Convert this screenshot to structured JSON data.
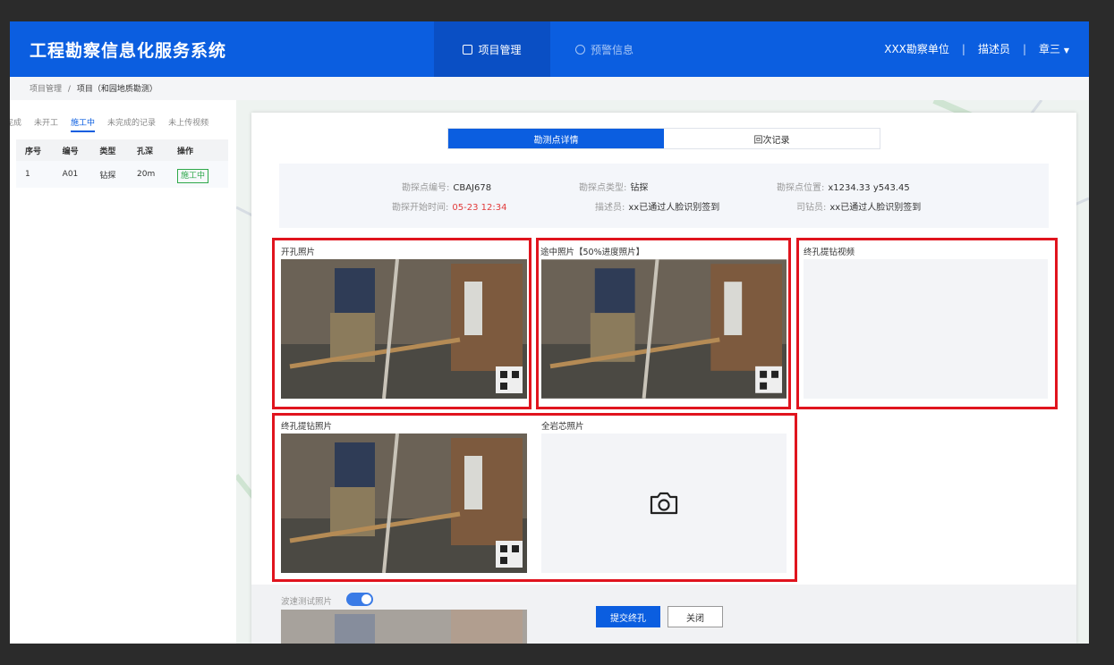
{
  "header": {
    "app_title": "工程勘察信息化服务系统",
    "nav": [
      {
        "label": "项目管理",
        "icon": "clipboard-icon",
        "active": true
      },
      {
        "label": "预警信息",
        "icon": "alert-circle-icon",
        "active": false
      }
    ],
    "org": "XXX勘察单位",
    "sep1": "|",
    "role": "描述员",
    "sep2": "|",
    "user": "章三"
  },
  "breadcrumb": {
    "parent": "项目管理",
    "divider": "/",
    "current": "项目（和园地质勘测）"
  },
  "left_panel": {
    "tabs": [
      "已完成",
      "未开工",
      "施工中",
      "未完成的记录",
      "未上传视频"
    ],
    "active_tab": "施工中",
    "columns": [
      "序号",
      "编号",
      "类型",
      "孔深",
      "操作"
    ],
    "rows": [
      {
        "index": "1",
        "code": "A01",
        "type": "钻探",
        "depth": "20m",
        "status": "施工中"
      }
    ]
  },
  "modal": {
    "tabs": [
      "勘测点详情",
      "回次记录"
    ],
    "info": {
      "point_code_label": "勘探点编号:",
      "point_code": "CBAJ678",
      "point_type_label": "勘探点类型:",
      "point_type": "钻探",
      "point_pos_label": "勘探点位置:",
      "point_pos": "x1234.33 y543.45",
      "start_time_label": "勘探开始时间:",
      "start_time": "05-23 12:34",
      "describer_label": "描述员:",
      "describer": "xx已通过人脸识别签到",
      "driller_label": "司钻员:",
      "driller": "xx已通过人脸识别签到"
    },
    "sections": {
      "open_photo": "开孔照片",
      "mid_photo": "途中照片【50%进度照片】",
      "final_video": "终孔提钻视频",
      "final_photo": "终孔提钻照片",
      "core_photo": "全岩芯照片",
      "wave_photo": "波速测试照片"
    },
    "buttons": {
      "submit": "提交终孔",
      "close": "关闭"
    }
  },
  "colors": {
    "primary": "#0b5ee0",
    "highlight_frame": "#e0141e",
    "alert_text": "#e23b3b",
    "status_green": "#2ea84a"
  }
}
